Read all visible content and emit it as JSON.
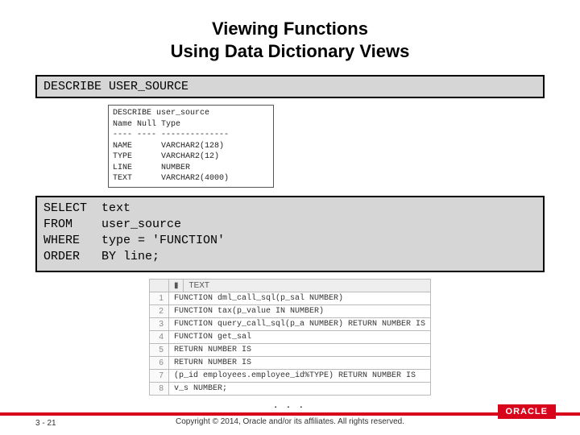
{
  "title_line1": "Viewing Functions",
  "title_line2": "Using Data Dictionary Views",
  "codebox1": "DESCRIBE USER_SOURCE",
  "describe_output": "DESCRIBE user_source\nName Null Type\n---- ---- --------------\nNAME      VARCHAR2(128)\nTYPE      VARCHAR2(12)\nLINE      NUMBER\nTEXT      VARCHAR2(4000)",
  "codebox2": "SELECT  text\nFROM    user_source\nWHERE   type = 'FUNCTION'\nORDER   BY line;",
  "result_header_sel": "▮",
  "result_header_text": "TEXT",
  "result_rows": [
    {
      "n": "1",
      "text": "FUNCTION dml_call_sql(p_sal NUMBER)"
    },
    {
      "n": "2",
      "text": "FUNCTION tax(p_value IN NUMBER)"
    },
    {
      "n": "3",
      "text": "FUNCTION query_call_sql(p_a NUMBER) RETURN NUMBER IS"
    },
    {
      "n": "4",
      "text": "FUNCTION get_sal"
    },
    {
      "n": "5",
      "text": " RETURN NUMBER IS"
    },
    {
      "n": "6",
      "text": "   RETURN NUMBER IS"
    },
    {
      "n": "7",
      "text": " (p_id  employees.employee_id%TYPE) RETURN NUMBER IS"
    },
    {
      "n": "8",
      "text": "  v_s NUMBER;"
    }
  ],
  "ellipsis": ". . .",
  "pagenum": "3 - 21",
  "copyright": "Copyright © 2014, Oracle and/or its affiliates. All rights reserved.",
  "logo": "ORACLE"
}
